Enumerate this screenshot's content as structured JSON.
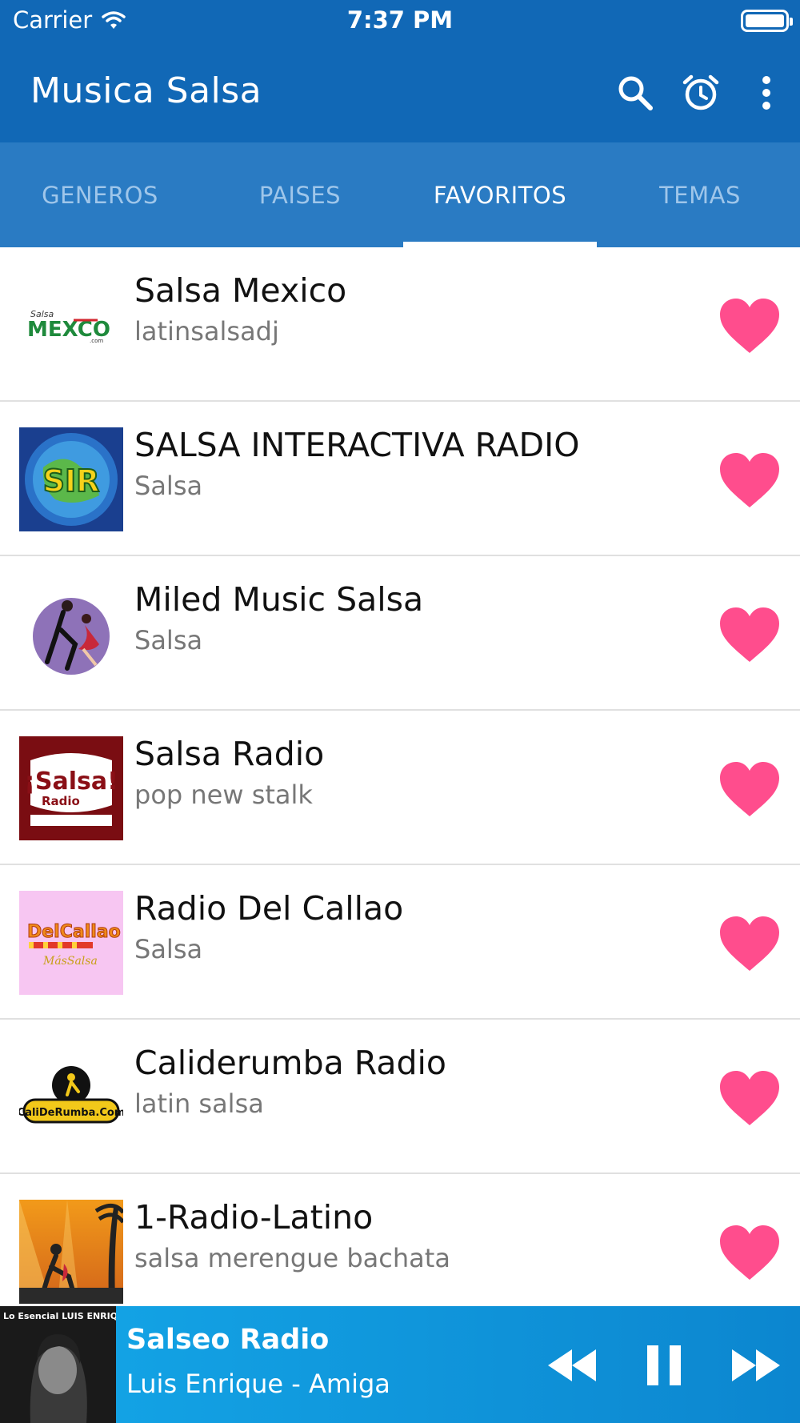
{
  "status_bar": {
    "carrier": "Carrier",
    "time": "7:37 PM"
  },
  "app_bar": {
    "title": "Musica Salsa",
    "icons": [
      "search-icon",
      "alarm-icon",
      "more-vert-icon"
    ]
  },
  "tabs": [
    {
      "label": "GENEROS",
      "active": false
    },
    {
      "label": "PAISES",
      "active": false
    },
    {
      "label": "FAVORITOS",
      "active": true
    },
    {
      "label": "TEMAS",
      "active": false
    }
  ],
  "stations": [
    {
      "title": "Salsa Mexico",
      "subtitle": "latinsalsadj",
      "logo": "salsa-mexico-logo",
      "logo_text": "MEXCO"
    },
    {
      "title": "SALSA INTERACTIVA RADIO",
      "subtitle": "Salsa",
      "logo": "sir-logo",
      "logo_text": "SIR"
    },
    {
      "title": "Miled Music Salsa",
      "subtitle": "Salsa",
      "logo": "dancers-logo",
      "logo_text": ""
    },
    {
      "title": "Salsa Radio",
      "subtitle": "pop new stalk",
      "logo": "salsa-radio-logo",
      "logo_text": "¡Salsa!"
    },
    {
      "title": "Radio Del Callao",
      "subtitle": "Salsa",
      "logo": "del-callao-logo",
      "logo_text": "DelCallao"
    },
    {
      "title": "Caliderumba Radio",
      "subtitle": "latin salsa",
      "logo": "caliderumba-logo",
      "logo_text": "CaliDeRumba.Com"
    },
    {
      "title": "1-Radio-Latino",
      "subtitle": "salsa merengue bachata",
      "logo": "radio-latino-logo",
      "logo_text": ""
    }
  ],
  "now_playing": {
    "title": "Salseo Radio",
    "subtitle": "Luis Enrique - Amiga",
    "cover_caption": "Lo Esencial LUIS ENRIQUE",
    "controls": [
      "rewind-icon",
      "pause-icon",
      "fast-forward-icon"
    ]
  },
  "colors": {
    "app_bar": "#1168b6",
    "tabs": "#2a7bc3",
    "heart": "#ff4d8d",
    "player": "#14a7e8"
  }
}
